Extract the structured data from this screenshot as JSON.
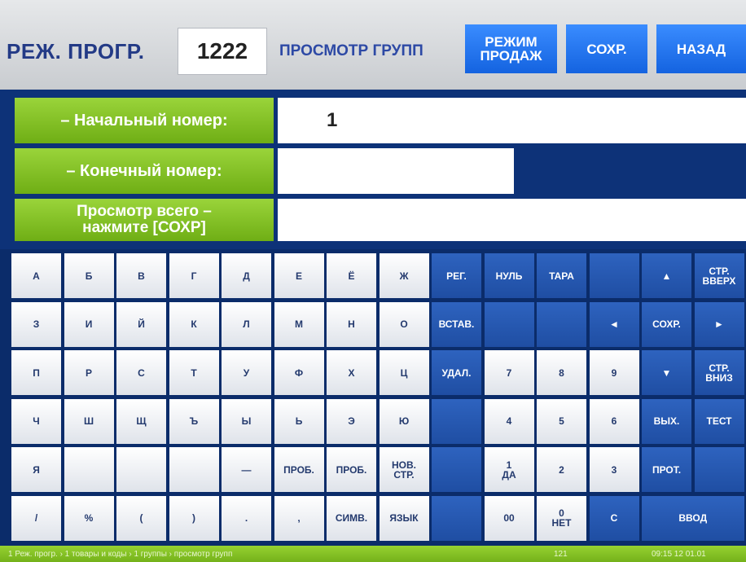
{
  "header": {
    "mode_label": "РЕЖ. ПРОГР.",
    "program_number": "1222",
    "screen_title": "ПРОСМОТР ГРУПП",
    "sales_mode_button": "РЕЖИМ\nПРОДАЖ",
    "save_button": "СОХР.",
    "back_button": "НАЗАД"
  },
  "form": {
    "start_label": "– Начальный номер:",
    "start_value": "1",
    "end_label": "– Конечный номер:",
    "end_value": "",
    "view_all_label": "Просмотр всего –\nнажмите [СОХР]",
    "view_all_value": ""
  },
  "keyboard": {
    "keys": [
      {
        "label": "А",
        "style": "w"
      },
      {
        "label": "Б",
        "style": "w"
      },
      {
        "label": "В",
        "style": "w"
      },
      {
        "label": "Г",
        "style": "w"
      },
      {
        "label": "Д",
        "style": "w"
      },
      {
        "label": "Е",
        "style": "w"
      },
      {
        "label": "Ё",
        "style": "w"
      },
      {
        "label": "Ж",
        "style": "w"
      },
      {
        "label": "РЕГ.",
        "style": "b"
      },
      {
        "label": "НУЛЬ",
        "style": "b"
      },
      {
        "label": "ТАРА",
        "style": "b"
      },
      {
        "label": "",
        "style": "b"
      },
      {
        "label": "▲",
        "style": "b"
      },
      {
        "label": "СТР.\nВВЕРХ",
        "style": "b"
      },
      {
        "label": "З",
        "style": "w"
      },
      {
        "label": "И",
        "style": "w"
      },
      {
        "label": "Й",
        "style": "w"
      },
      {
        "label": "К",
        "style": "w"
      },
      {
        "label": "Л",
        "style": "w"
      },
      {
        "label": "М",
        "style": "w"
      },
      {
        "label": "Н",
        "style": "w"
      },
      {
        "label": "О",
        "style": "w"
      },
      {
        "label": "ВСТАВ.",
        "style": "b"
      },
      {
        "label": "",
        "style": "b"
      },
      {
        "label": "",
        "style": "b"
      },
      {
        "label": "◄",
        "style": "b"
      },
      {
        "label": "СОХР.",
        "style": "b"
      },
      {
        "label": "►",
        "style": "b"
      },
      {
        "label": "П",
        "style": "w"
      },
      {
        "label": "Р",
        "style": "w"
      },
      {
        "label": "С",
        "style": "w"
      },
      {
        "label": "Т",
        "style": "w"
      },
      {
        "label": "У",
        "style": "w"
      },
      {
        "label": "Ф",
        "style": "w"
      },
      {
        "label": "Х",
        "style": "w"
      },
      {
        "label": "Ц",
        "style": "w"
      },
      {
        "label": "УДАЛ.",
        "style": "b"
      },
      {
        "label": "7",
        "style": "w"
      },
      {
        "label": "8",
        "style": "w"
      },
      {
        "label": "9",
        "style": "w"
      },
      {
        "label": "▼",
        "style": "b"
      },
      {
        "label": "СТР.\nВНИЗ",
        "style": "b"
      },
      {
        "label": "Ч",
        "style": "w"
      },
      {
        "label": "Ш",
        "style": "w"
      },
      {
        "label": "Щ",
        "style": "w"
      },
      {
        "label": "Ъ",
        "style": "w"
      },
      {
        "label": "Ы",
        "style": "w"
      },
      {
        "label": "Ь",
        "style": "w"
      },
      {
        "label": "Э",
        "style": "w"
      },
      {
        "label": "Ю",
        "style": "w"
      },
      {
        "label": "",
        "style": "b"
      },
      {
        "label": "4",
        "style": "w"
      },
      {
        "label": "5",
        "style": "w"
      },
      {
        "label": "6",
        "style": "w"
      },
      {
        "label": "ВЫХ.",
        "style": "b"
      },
      {
        "label": "ТЕСТ",
        "style": "b"
      },
      {
        "label": "Я",
        "style": "w"
      },
      {
        "label": "",
        "style": "w"
      },
      {
        "label": "",
        "style": "w"
      },
      {
        "label": "",
        "style": "w"
      },
      {
        "label": "—",
        "style": "w"
      },
      {
        "label": "ПРОБ.",
        "style": "w"
      },
      {
        "label": "ПРОБ.",
        "style": "w"
      },
      {
        "label": "НОВ.\nСТР.",
        "style": "w"
      },
      {
        "label": "",
        "style": "b"
      },
      {
        "label": "1\nДА",
        "style": "w"
      },
      {
        "label": "2",
        "style": "w"
      },
      {
        "label": "3",
        "style": "w"
      },
      {
        "label": "ПРОТ.",
        "style": "b"
      },
      {
        "label": "",
        "style": "b"
      },
      {
        "label": "/",
        "style": "w"
      },
      {
        "label": "%",
        "style": "w"
      },
      {
        "label": "(",
        "style": "w"
      },
      {
        "label": ")",
        "style": "w"
      },
      {
        "label": ".",
        "style": "w"
      },
      {
        "label": ",",
        "style": "w"
      },
      {
        "label": "СИМВ.",
        "style": "w"
      },
      {
        "label": "ЯЗЫК",
        "style": "w"
      },
      {
        "label": "",
        "style": "b"
      },
      {
        "label": "00",
        "style": "w"
      },
      {
        "label": "0\nНЕТ",
        "style": "w"
      },
      {
        "label": "С",
        "style": "b"
      },
      {
        "label": "ВВОД",
        "style": "b",
        "span": 2
      }
    ]
  },
  "status_bar": {
    "left_text": "1 Реж. прогр. › 1 товары и коды › 1 группы › просмотр групп",
    "middle_text": "121",
    "right_text": "09:15 12 01.01"
  }
}
